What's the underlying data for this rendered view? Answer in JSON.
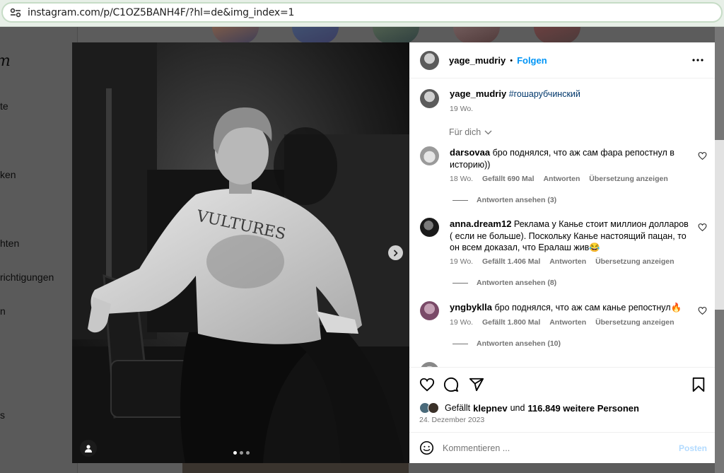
{
  "browser": {
    "url": "instagram.com/p/C1OZ5BANH4F/?hl=de&img_index=1"
  },
  "background_nav": {
    "logo": "m",
    "items": [
      "te",
      "ken",
      "hten",
      "richtigungen",
      "n",
      "s"
    ]
  },
  "post": {
    "author": "yage_mudriy",
    "follow_label": "Folgen",
    "separator": "•",
    "caption_hashtag": "#гошарубчинский",
    "caption_age": "19 Wo.",
    "sort_label": "Für dich",
    "image_dots": 3,
    "active_dot": 0,
    "icons": {
      "more": "more-horizontal-icon",
      "next": "chevron-right-icon",
      "tag": "user-tag-icon",
      "like": "heart-icon",
      "comment": "comment-icon",
      "share": "share-icon",
      "save": "bookmark-icon",
      "emoji": "emoji-icon"
    }
  },
  "comments": [
    {
      "user": "darsovaa",
      "text": "бро поднялся, что аж сам фара репостнул в историю))",
      "age": "18 Wo.",
      "likes": "Gefällt 690 Mal",
      "reply": "Antworten",
      "translate": "Übersetzung anzeigen",
      "view_replies": "Antworten ansehen (3)"
    },
    {
      "user": "anna.dream12",
      "text": "Реклама у Канье стоит миллион долларов ( если не больше). Поскольку Канье настоящий пацан, то он всем доказал, что Ералаш жив😂",
      "age": "19 Wo.",
      "likes": "Gefällt 1.406 Mal",
      "reply": "Antworten",
      "translate": "Übersetzung anzeigen",
      "view_replies": "Antworten ansehen (8)"
    },
    {
      "user": "yngbyklla",
      "text": "бро поднялся, что аж сам канье репостнул🔥",
      "age": "19 Wo.",
      "likes": "Gefällt 1.800 Mal",
      "reply": "Antworten",
      "translate": "Übersetzung anzeigen",
      "view_replies": "Antworten ansehen (10)"
    }
  ],
  "likes_summary": {
    "prefix": "Gefällt",
    "user": "klepnev",
    "middle": "und",
    "count": "116.849 weitere Personen"
  },
  "post_date": "24. Dezember 2023",
  "add_comment": {
    "placeholder": "Kommentieren ...",
    "submit_label": "Posten"
  }
}
